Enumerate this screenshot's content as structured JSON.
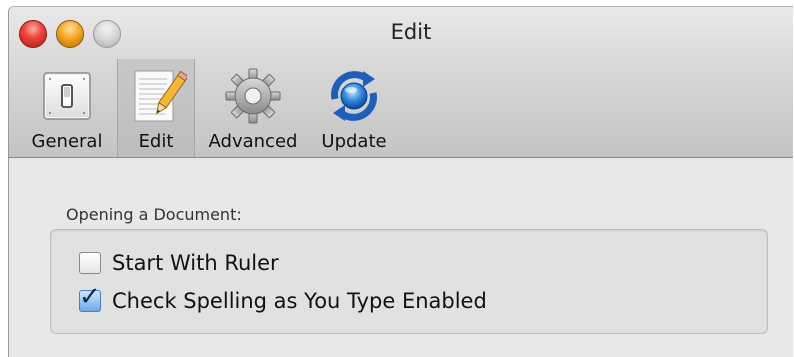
{
  "window": {
    "title": "Edit"
  },
  "toolbar": {
    "items": [
      {
        "label": "General",
        "icon": "toggle-switch-icon",
        "selected": false
      },
      {
        "label": "Edit",
        "icon": "document-pencil-icon",
        "selected": true
      },
      {
        "label": "Advanced",
        "icon": "gear-icon",
        "selected": false
      },
      {
        "label": "Update",
        "icon": "refresh-globe-icon",
        "selected": false
      }
    ]
  },
  "section": {
    "title": "Opening a Document:",
    "options": [
      {
        "label": "Start With Ruler",
        "checked": false
      },
      {
        "label": "Check Spelling as You Type Enabled",
        "checked": true
      }
    ]
  },
  "colors": {
    "close": "#f0463c",
    "minimize": "#f5a623",
    "zoom": "#d2d2d2",
    "checkbox_checked": "#6fa9e8"
  }
}
